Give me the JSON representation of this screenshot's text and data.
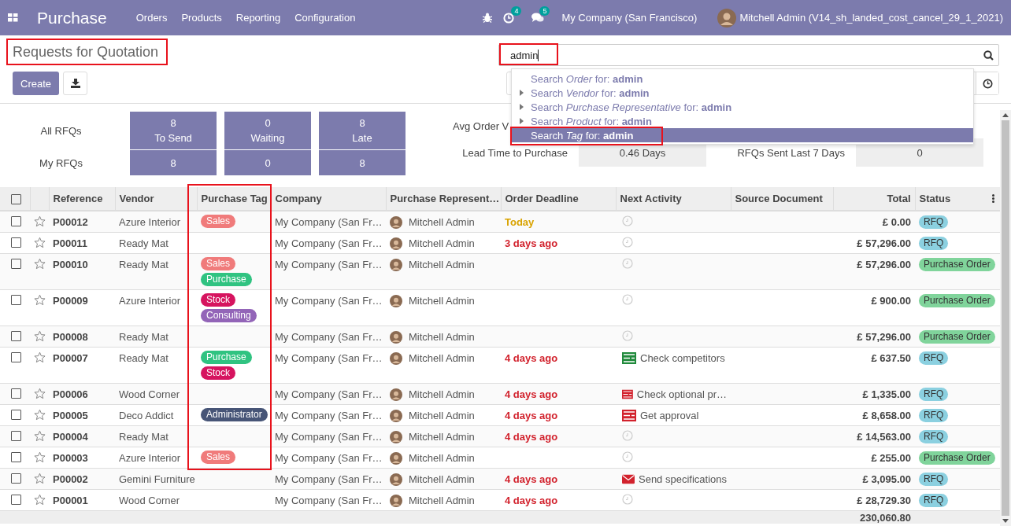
{
  "navbar": {
    "app_name": "Purchase",
    "menus": [
      "Orders",
      "Products",
      "Reporting",
      "Configuration"
    ],
    "activity_count": "4",
    "message_count": "5",
    "company": "My Company (San Francisco)",
    "user": "Mitchell Admin (V14_sh_landed_cost_cancel_29_1_2021)"
  },
  "control_panel": {
    "breadcrumb": "Requests for Quotation",
    "breadcrumb_annotated": true,
    "create_button": "Create",
    "search": {
      "value": "admin",
      "annotated": true
    },
    "suggestions": [
      {
        "text": "Search *Order* for: **admin**",
        "expandable": false,
        "selected": false,
        "annotated": false
      },
      {
        "text": "Search *Vendor* for: **admin**",
        "expandable": true,
        "selected": false,
        "annotated": false
      },
      {
        "text": "Search *Purchase Representative* for: **admin**",
        "expandable": true,
        "selected": false,
        "annotated": false
      },
      {
        "text": "Search *Product* for: **admin**",
        "expandable": true,
        "selected": false,
        "annotated": false
      },
      {
        "text": "Search *Tag* for: **admin**",
        "expandable": false,
        "selected": true,
        "annotated": true
      }
    ]
  },
  "dashboard": {
    "row_labels": [
      "All RFQs",
      "My RFQs"
    ],
    "tiles": [
      {
        "count": "8",
        "label": "To Send",
        "my_count": "8"
      },
      {
        "count": "0",
        "label": "Waiting",
        "my_count": "0"
      },
      {
        "count": "8",
        "label": "Late",
        "my_count": "8"
      }
    ],
    "stats": {
      "avg_label": "Avg Order V",
      "lead_label": "Lead Time to Purchase",
      "lead_value": "0.46  Days",
      "sent_label": "RFQs Sent Last 7 Days",
      "sent_value": "0"
    }
  },
  "table": {
    "all_selected": false,
    "columns": [
      {
        "label": "Reference",
        "annotated": false
      },
      {
        "label": "Vendor",
        "annotated": false
      },
      {
        "label": "Purchase Tag",
        "annotated": true
      },
      {
        "label": "Company",
        "annotated": false
      },
      {
        "label": "Purchase Represent…",
        "annotated": false
      },
      {
        "label": "Order Deadline",
        "annotated": false
      },
      {
        "label": "Next Activity",
        "annotated": false
      },
      {
        "label": "Source Document",
        "annotated": false
      },
      {
        "label": "Total",
        "annotated": false
      },
      {
        "label": "Status",
        "annotated": false
      }
    ],
    "rows": [
      {
        "selected": false,
        "starred": false,
        "reference": "P00012",
        "vendor": "Azure Interior",
        "tags": [
          {
            "label": "Sales",
            "color": "#f07b7b"
          }
        ],
        "company": "My Company (San Fr…",
        "representative": "Mitchell Admin",
        "deadline": {
          "text": "Today",
          "overdue": false
        },
        "activity": {
          "kind": "none"
        },
        "total": "£ 0.00",
        "status": {
          "label": "RFQ",
          "kind": "rfq"
        }
      },
      {
        "selected": false,
        "starred": false,
        "reference": "P00011",
        "vendor": "Ready Mat",
        "tags": [],
        "company": "My Company (San Fr…",
        "representative": "Mitchell Admin",
        "deadline": {
          "text": "3 days ago",
          "overdue": true
        },
        "activity": {
          "kind": "none"
        },
        "total": "£ 57,296.00",
        "status": {
          "label": "RFQ",
          "kind": "rfq"
        }
      },
      {
        "selected": false,
        "starred": false,
        "reference": "P00010",
        "vendor": "Ready Mat",
        "tags": [
          {
            "label": "Sales",
            "color": "#f07b7b"
          },
          {
            "label": "Purchase",
            "color": "#30c381"
          }
        ],
        "company": "My Company (San Fr…",
        "representative": "Mitchell Admin",
        "activity": {
          "kind": "none"
        },
        "total": "£ 57,296.00",
        "status": {
          "label": "Purchase Order",
          "kind": "purchase"
        }
      },
      {
        "selected": false,
        "starred": false,
        "reference": "P00009",
        "vendor": "Azure Interior",
        "tags": [
          {
            "label": "Stock",
            "color": "#d6145f"
          },
          {
            "label": "Consulting",
            "color": "#9365b8"
          }
        ],
        "company": "My Company (San Fr…",
        "representative": "Mitchell Admin",
        "activity": {
          "kind": "none"
        },
        "total": "£ 900.00",
        "status": {
          "label": "Purchase Order",
          "kind": "purchase"
        }
      },
      {
        "selected": false,
        "starred": false,
        "reference": "P00008",
        "vendor": "Ready Mat",
        "tags": [],
        "company": "My Company (San Fr…",
        "representative": "Mitchell Admin",
        "activity": {
          "kind": "none"
        },
        "total": "£ 57,296.00",
        "status": {
          "label": "Purchase Order",
          "kind": "purchase"
        }
      },
      {
        "selected": false,
        "starred": false,
        "reference": "P00007",
        "vendor": "Ready Mat",
        "tags": [
          {
            "label": "Purchase",
            "color": "#30c381"
          },
          {
            "label": "Stock",
            "color": "#d6145f"
          }
        ],
        "company": "My Company (San Fr…",
        "representative": "Mitchell Admin",
        "deadline": {
          "text": "4 days ago",
          "overdue": true
        },
        "activity": {
          "kind": "todo",
          "overdue": false,
          "summary": "Check competitors"
        },
        "total": "£ 637.50",
        "status": {
          "label": "RFQ",
          "kind": "rfq"
        }
      },
      {
        "selected": false,
        "starred": false,
        "reference": "P00006",
        "vendor": "Wood Corner",
        "tags": [],
        "company": "My Company (San Fr…",
        "representative": "Mitchell Admin",
        "deadline": {
          "text": "4 days ago",
          "overdue": true
        },
        "activity": {
          "kind": "todo",
          "overdue": true,
          "summary": "Check optional pr…"
        },
        "total": "£ 1,335.00",
        "status": {
          "label": "RFQ",
          "kind": "rfq"
        }
      },
      {
        "selected": false,
        "starred": false,
        "reference": "P00005",
        "vendor": "Deco Addict",
        "tags": [
          {
            "label": "Administrator",
            "color": "#475577"
          }
        ],
        "company": "My Company (San Fr…",
        "representative": "Mitchell Admin",
        "deadline": {
          "text": "4 days ago",
          "overdue": true
        },
        "activity": {
          "kind": "todo",
          "overdue": true,
          "summary": "Get approval"
        },
        "total": "£ 8,658.00",
        "status": {
          "label": "RFQ",
          "kind": "rfq"
        }
      },
      {
        "selected": false,
        "starred": false,
        "reference": "P00004",
        "vendor": "Ready Mat",
        "tags": [],
        "company": "My Company (San Fr…",
        "representative": "Mitchell Admin",
        "deadline": {
          "text": "4 days ago",
          "overdue": true
        },
        "activity": {
          "kind": "none"
        },
        "total": "£ 14,563.00",
        "status": {
          "label": "RFQ",
          "kind": "rfq"
        }
      },
      {
        "selected": false,
        "starred": false,
        "reference": "P00003",
        "vendor": "Azure Interior",
        "tags": [
          {
            "label": "Sales",
            "color": "#f07b7b"
          }
        ],
        "company": "My Company (San Fr…",
        "representative": "Mitchell Admin",
        "activity": {
          "kind": "none"
        },
        "total": "£ 255.00",
        "status": {
          "label": "Purchase Order",
          "kind": "purchase"
        }
      },
      {
        "selected": false,
        "starred": false,
        "reference": "P00002",
        "vendor": "Gemini Furniture",
        "tags": [],
        "company": "My Company (San Fr…",
        "representative": "Mitchell Admin",
        "deadline": {
          "text": "4 days ago",
          "overdue": true
        },
        "activity": {
          "kind": "email",
          "overdue": true,
          "summary": "Send specifications"
        },
        "total": "£ 3,095.00",
        "status": {
          "label": "RFQ",
          "kind": "rfq"
        }
      },
      {
        "selected": false,
        "starred": false,
        "reference": "P00001",
        "vendor": "Wood Corner",
        "tags": [],
        "company": "My Company (San Fr…",
        "representative": "Mitchell Admin",
        "deadline": {
          "text": "4 days ago",
          "overdue": true
        },
        "activity": {
          "kind": "none"
        },
        "total": "£ 28,729.30",
        "status": {
          "label": "RFQ",
          "kind": "rfq"
        }
      }
    ],
    "footer_total": "230,060.80"
  }
}
